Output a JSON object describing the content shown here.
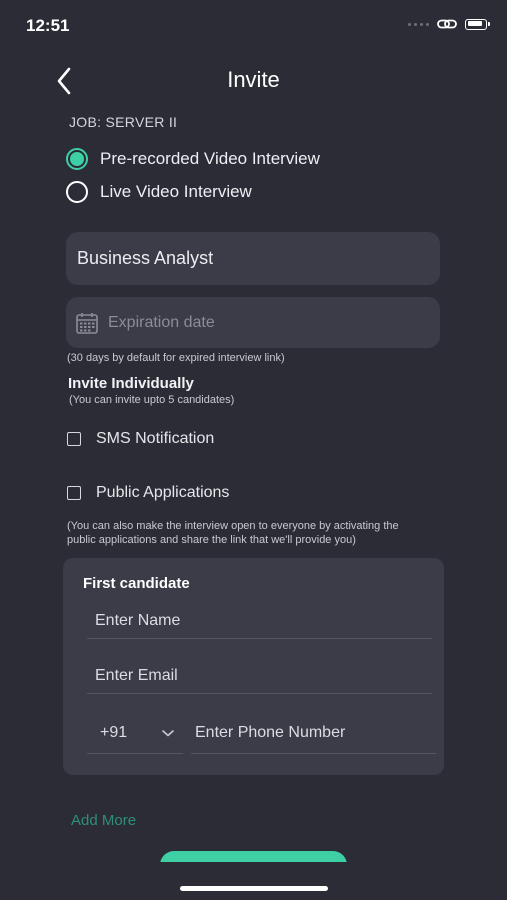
{
  "status_bar": {
    "time": "12:51"
  },
  "header": {
    "title": "Invite"
  },
  "job": {
    "label": "JOB: SERVER II"
  },
  "interview_type": {
    "options": [
      {
        "label": "Pre-recorded Video Interview",
        "selected": true
      },
      {
        "label": "Live Video Interview",
        "selected": false
      }
    ]
  },
  "role_field": {
    "value": "Business Analyst"
  },
  "expiration": {
    "placeholder": "Expiration date",
    "hint": "(30 days by default for expired interview link)"
  },
  "invite_individually": {
    "heading": "Invite Individually",
    "subtext": "(You can invite upto 5 candidates)"
  },
  "sms": {
    "label": "SMS Notification",
    "checked": false
  },
  "public_applications": {
    "label": "Public Applications",
    "checked": false,
    "hint_line1": "(You can also make the interview open to everyone by activating the",
    "hint_line2": "public applications and share the link that we'll provide you)"
  },
  "candidate": {
    "title": "First candidate",
    "name_placeholder": "Enter Name",
    "email_placeholder": "Enter Email",
    "country_code": "+91",
    "phone_placeholder": "Enter Phone Number"
  },
  "add_more": {
    "label": "Add More"
  },
  "colors": {
    "accent": "#3ecfa5",
    "background": "#2b2c36",
    "field": "#3b3c47"
  }
}
